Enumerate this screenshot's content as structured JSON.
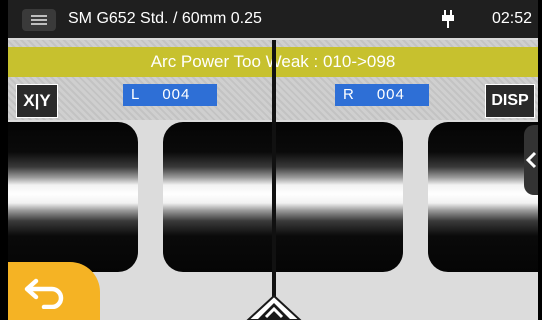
{
  "header": {
    "title": "SM G652 Std. / 60mm 0.25",
    "time": "02:52",
    "menu_icon": "hamburger-icon",
    "power_icon": "ac-plug-icon"
  },
  "alert": {
    "message": "Arc Power Too Weak : 010->098",
    "color": "#c7c12e"
  },
  "left_label": {
    "side": "L",
    "value": "004"
  },
  "right_label": {
    "side": "R",
    "value": "004"
  },
  "buttons": {
    "xy": "X|Y",
    "disp": "DISP",
    "back_icon": "back-arrow-icon",
    "side_panel_icon": "chevron-left-icon",
    "bottom_handle_icon": "chevron-up-icon"
  },
  "colors": {
    "label_box": "#2e6fd6",
    "back_button": "#f5b324"
  }
}
